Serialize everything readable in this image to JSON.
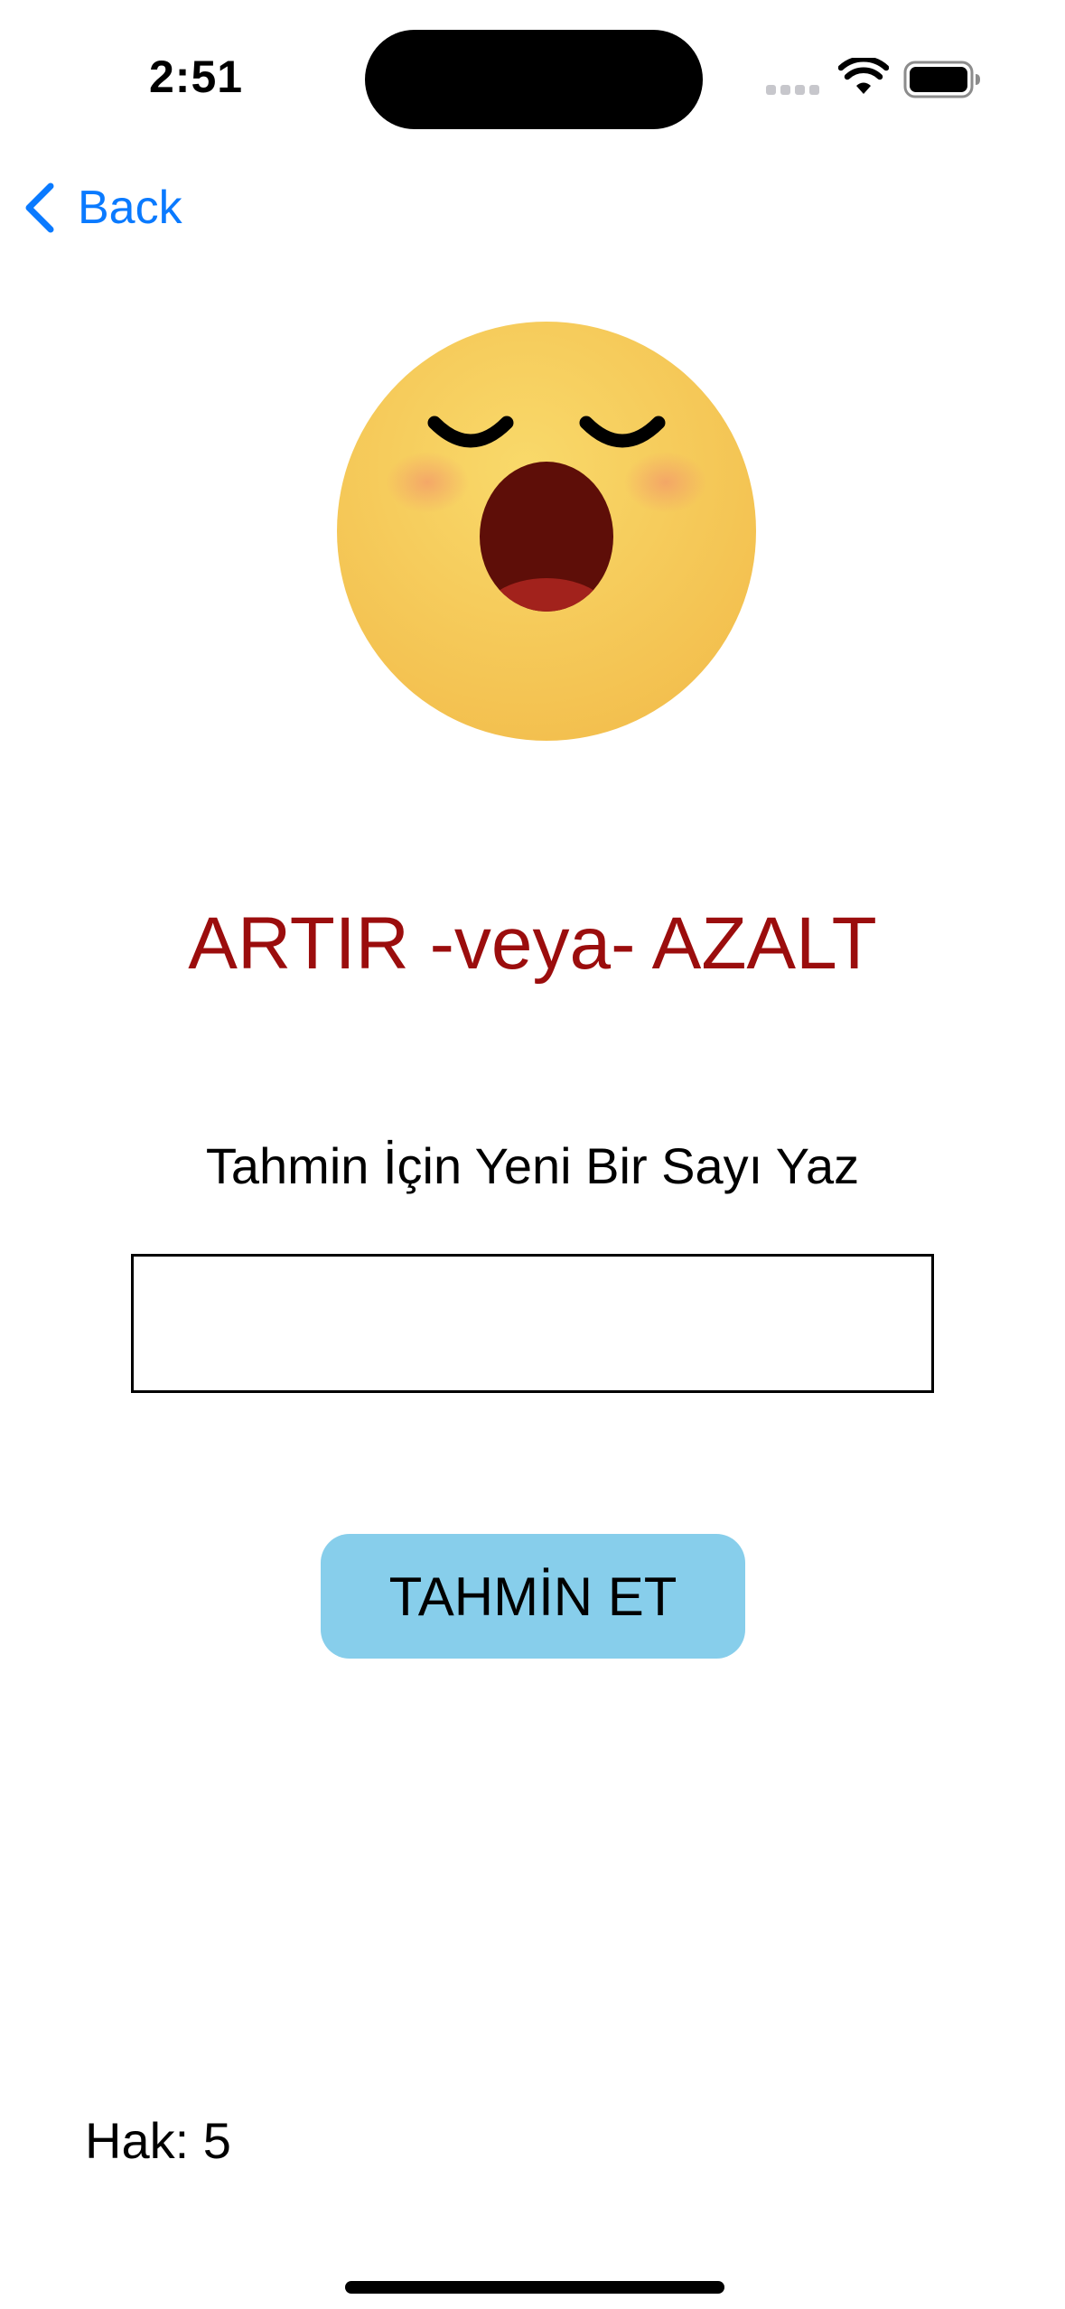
{
  "status_bar": {
    "time": "2:51",
    "signal_icon": "cellular-signal-icon",
    "wifi_icon": "wifi-icon",
    "battery_icon": "battery-full-icon"
  },
  "nav": {
    "back_label": "Back",
    "back_icon": "chevron-left-icon",
    "accent_color": "#0a7aff"
  },
  "emoji": {
    "icon": "yawning-face-emoji"
  },
  "game": {
    "headline": "ARTIR -veya- AZALT",
    "headline_color": "#9b0d0d",
    "prompt": "Tahmin İçin Yeni Bir Sayı Yaz",
    "input_value": "",
    "button_label": "TAHMİN ET",
    "button_color": "#87ceeb",
    "lives_label": "Hak: 5"
  }
}
